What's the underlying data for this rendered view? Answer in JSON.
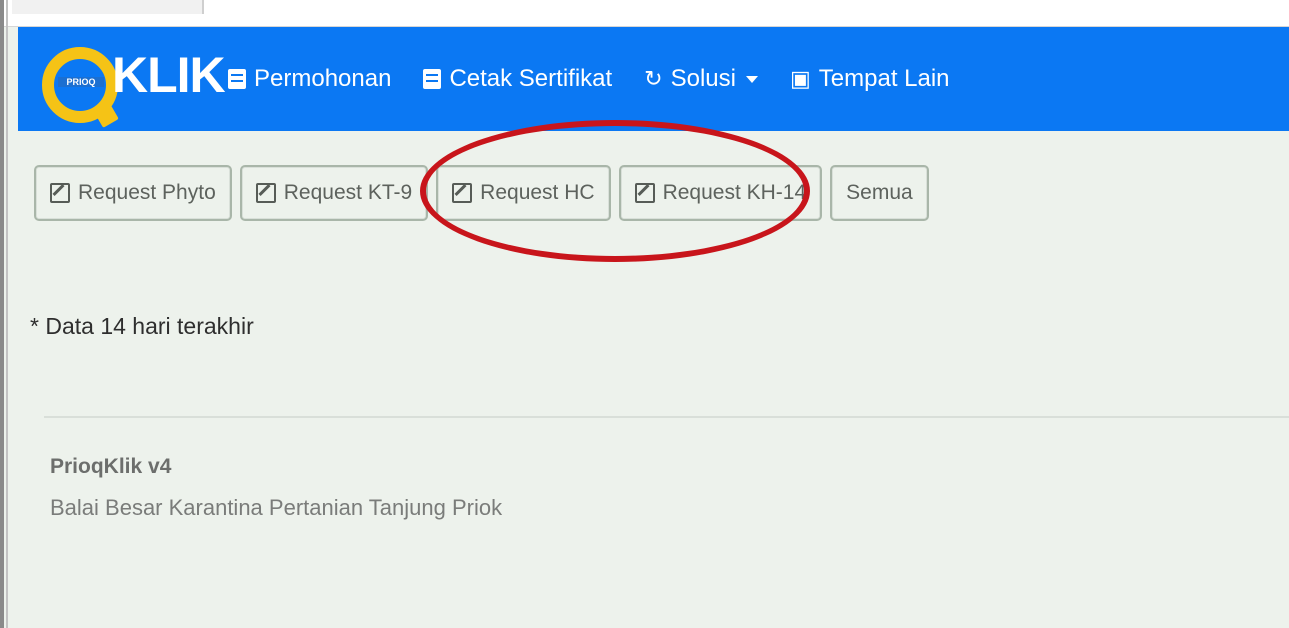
{
  "navbar": {
    "brand_small": "PRIOQ",
    "brand_main": "KLIK",
    "items": [
      {
        "label": "Permohonan"
      },
      {
        "label": "Cetak Sertifikat"
      },
      {
        "label": "Solusi"
      },
      {
        "label": "Tempat Lain"
      }
    ]
  },
  "actions": {
    "buttons": [
      {
        "label": "Request Phyto"
      },
      {
        "label": "Request KT-9"
      },
      {
        "label": "Request HC"
      },
      {
        "label": "Request KH-14"
      },
      {
        "label": "Semua"
      }
    ]
  },
  "main": {
    "note": "* Data 14 hari terakhir"
  },
  "footer": {
    "title": "PrioqKlik v4",
    "subtitle": "Balai Besar Karantina Pertanian Tanjung Priok"
  },
  "colors": {
    "navbar": "#0b78f3",
    "logo_accent": "#f5c316",
    "highlight": "#c8151b",
    "background": "#edf2ec"
  },
  "icons": {
    "permohonan": "file-icon",
    "cetak": "file-icon",
    "solusi": "refresh-icon",
    "tempat_lain": "briefcase-icon",
    "request": "edit-icon"
  }
}
